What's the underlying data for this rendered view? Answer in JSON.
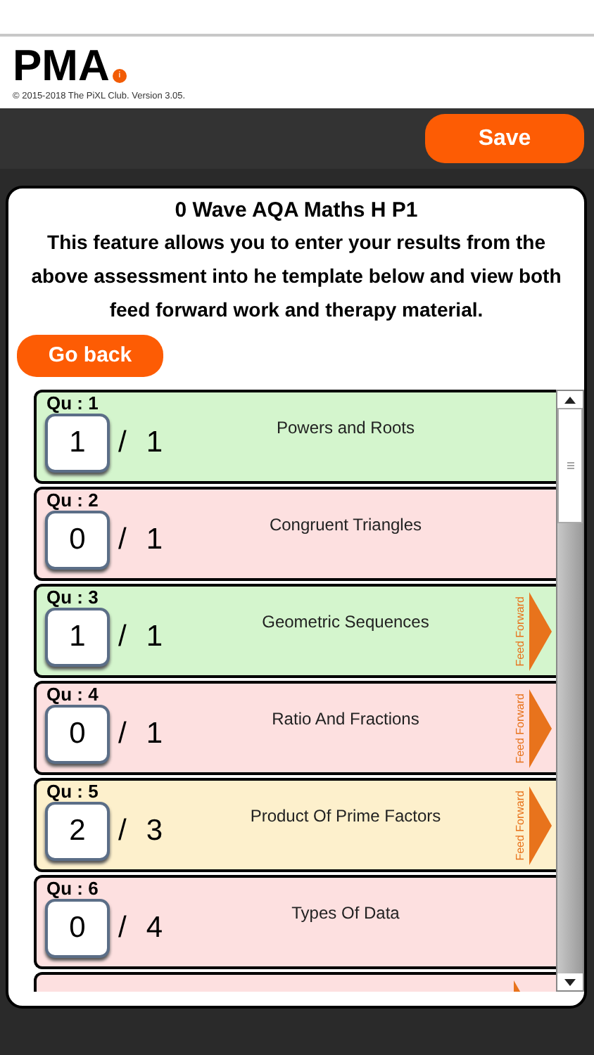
{
  "header": {
    "logo": "PMA",
    "logo_badge": "i",
    "copyright": "© 2015-2018 The PiXL Club. Version 3.05."
  },
  "toolbar": {
    "save_button": "Save"
  },
  "panel": {
    "title": "0 Wave AQA Maths H P1",
    "description": "This feature allows you to enter your results from the above assessment into he template below and view both feed forward work and therapy material.",
    "back_button": "Go back"
  },
  "questions": [
    {
      "label": "Qu : 1",
      "score": "1",
      "separator": "/",
      "max": "1",
      "topic": "Powers and Roots",
      "color": "#d4f5cd",
      "feed_forward": false
    },
    {
      "label": "Qu : 2",
      "score": "0",
      "separator": "/",
      "max": "1",
      "topic": "Congruent Triangles",
      "color": "#fde0e0",
      "feed_forward": false
    },
    {
      "label": "Qu : 3",
      "score": "1",
      "separator": "/",
      "max": "1",
      "topic": "Geometric Sequences",
      "color": "#d4f5cd",
      "feed_forward": true,
      "feed_forward_label": "Feed Forward"
    },
    {
      "label": "Qu : 4",
      "score": "0",
      "separator": "/",
      "max": "1",
      "topic": "Ratio And Fractions",
      "color": "#fde0e0",
      "feed_forward": true,
      "feed_forward_label": "Feed Forward"
    },
    {
      "label": "Qu : 5",
      "score": "2",
      "separator": "/",
      "max": "3",
      "topic": "Product Of Prime Factors",
      "color": "#fdf0cc",
      "feed_forward": true,
      "feed_forward_label": "Feed Forward"
    },
    {
      "label": "Qu : 6",
      "score": "0",
      "separator": "/",
      "max": "4",
      "topic": "Types Of Data",
      "color": "#fde0e0",
      "feed_forward": false
    },
    {
      "color": "#fde0e0",
      "feed_forward": true
    }
  ]
}
